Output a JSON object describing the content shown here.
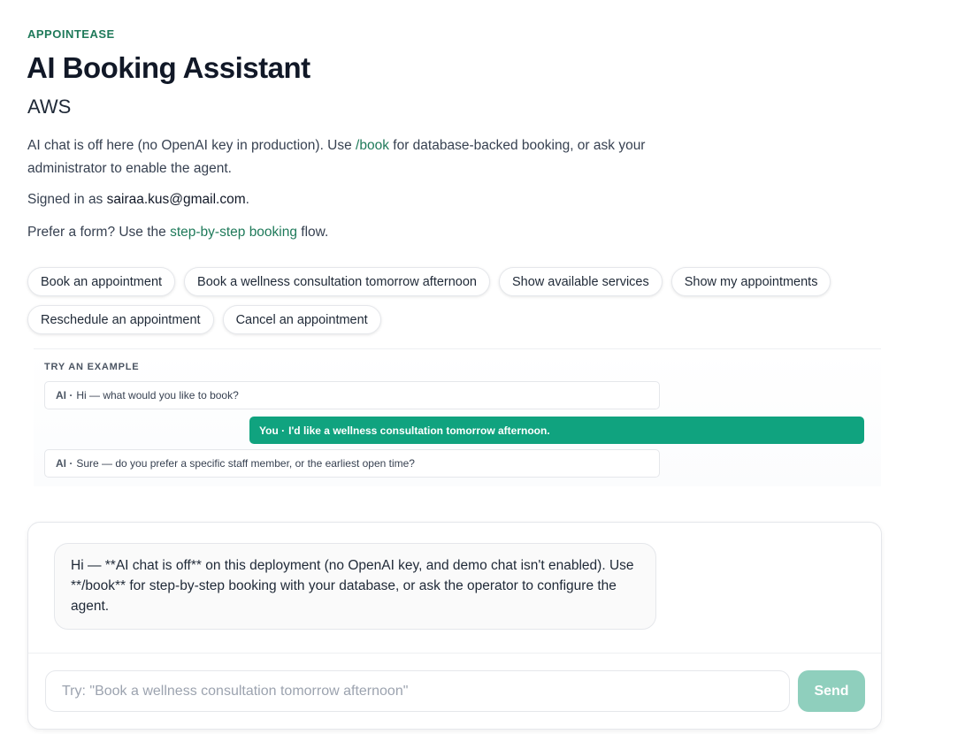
{
  "header": {
    "brand": "APPOINTEASE",
    "title": "AI Booking Assistant",
    "environment": "AWS"
  },
  "notice": {
    "before_link": "AI chat is off here (no OpenAI key in production). Use ",
    "link": "/book",
    "after_link": " for database-backed booking, or ask your administrator to enable the agent."
  },
  "signed_in": {
    "prefix": "Signed in as ",
    "email": "sairaa.kus@gmail.com",
    "suffix": "."
  },
  "prefer_form": {
    "before_link": "Prefer a form? Use the ",
    "link": "step-by-step booking",
    "after_link": " flow."
  },
  "suggestions": [
    "Book an appointment",
    "Book a wellness consultation tomorrow afternoon",
    "Show available services",
    "Show my appointments",
    "Reschedule an appointment",
    "Cancel an appointment"
  ],
  "example": {
    "label": "TRY AN EXAMPLE",
    "messages": [
      {
        "who": "AI ·",
        "text": "Hi — what would you like to book?"
      },
      {
        "who": "You ·",
        "text": "I'd like a wellness consultation tomorrow afternoon."
      },
      {
        "who": "AI ·",
        "text": "Sure — do you prefer a specific staff member, or the earliest open time?"
      }
    ]
  },
  "chat": {
    "assistant_message": "Hi — **AI chat is off** on this deployment (no OpenAI key, and demo chat isn't enabled). Use **/book** for step-by-step booking with your database, or ask the operator to configure the agent.",
    "input_placeholder": "Try: \"Book a wellness consultation tomorrow afternoon\"",
    "send_label": "Send"
  },
  "colors": {
    "accent": "#1f7a5a",
    "user_bubble": "#10a37f",
    "send_disabled": "#8fcfbd"
  }
}
